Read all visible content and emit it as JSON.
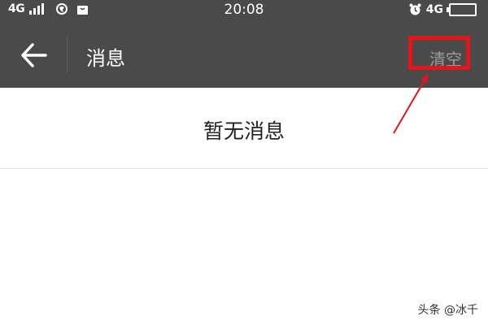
{
  "status_bar": {
    "network_left": "4G",
    "time": "20:08",
    "network_right": "4G",
    "icons": [
      "signal-icon",
      "globe-icon",
      "bag-icon",
      "alarm-icon",
      "battery-icon"
    ]
  },
  "nav": {
    "back_icon": "arrow-left-icon",
    "title": "消息",
    "clear_label": "清空"
  },
  "content": {
    "empty_text": "暂无消息"
  },
  "annotation": {
    "highlight_color": "#e8141b"
  },
  "watermark": {
    "text": "头条 @冰千"
  },
  "colors": {
    "header_bg": "#4a4a4a",
    "header_text": "#ffffff",
    "clear_text": "#9c9c9c",
    "body_bg": "#ffffff"
  }
}
